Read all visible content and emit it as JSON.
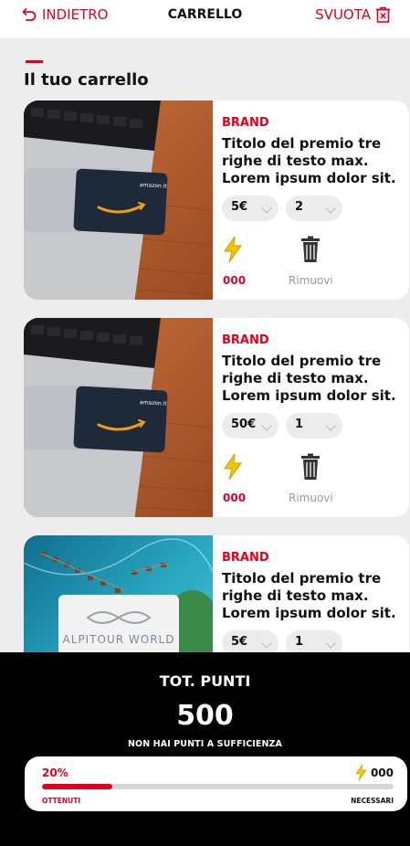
{
  "header": {
    "back_label": "INDIETRO",
    "title": "CARRELLO",
    "empty_label": "SVUOTA"
  },
  "cart": {
    "section_title": "Il tuo carrello",
    "items": [
      {
        "brand": "BRAND",
        "title": "Titolo del premio tre righe di testo max. Lorem ipsum dolor sit.",
        "value": "5€",
        "quantity": "2",
        "points": "000",
        "remove_label": "Rimuovi",
        "image_icon": "amazon-gift-card-image",
        "image_text": "amazon.it"
      },
      {
        "brand": "BRAND",
        "title": "Titolo del premio tre righe di testo max. Lorem ipsum dolor sit.",
        "value": "50€",
        "quantity": "1",
        "points": "000",
        "remove_label": "Rimuovi",
        "image_icon": "amazon-gift-card-image",
        "image_text": "amazon.it"
      },
      {
        "brand": "BRAND",
        "title": "Titolo del premio tre righe di testo max. Lorem ipsum dolor sit.",
        "value": "5€",
        "quantity": "1",
        "image_icon": "alpitour-resort-image",
        "image_text": "ALPITOUR WORLD"
      }
    ]
  },
  "summary": {
    "total_label": "TOT. PUNTI",
    "total_value": "500",
    "warning": "NON HAI PUNTI A SUFFICIENZA",
    "progress_percent_label": "20%",
    "progress_fraction": 0.2,
    "needed_points": "000",
    "obtained_label": "OTTENUTI",
    "needed_label": "NECESSARI"
  },
  "colors": {
    "accent": "#e4001c",
    "bolt": "#f5c400",
    "amazon_card": "#1e2a3a",
    "amazon_smile": "#f29b1a"
  },
  "icons": {
    "back": "undo-arrow-icon",
    "empty": "trash-x-icon",
    "points": "lightning-bolt-icon",
    "remove": "trash-can-icon"
  }
}
